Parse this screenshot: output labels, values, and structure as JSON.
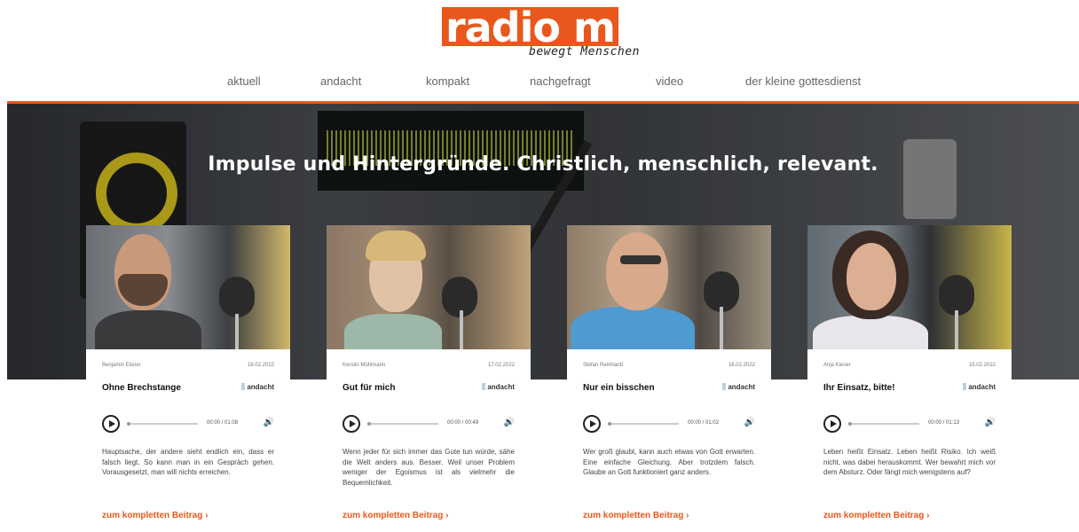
{
  "brand": {
    "logo_text": "radio m",
    "tagline": "bewegt Menschen",
    "accent": "#e8581c"
  },
  "nav": {
    "items": [
      "aktuell",
      "andacht",
      "kompakt",
      "nachgefragt",
      "video",
      "der kleine gottesdienst"
    ]
  },
  "hero": {
    "title": "Impulse und Hintergründe. Christlich, menschlich, relevant."
  },
  "cards": [
    {
      "author": "Benjamin Elsner",
      "date": "18.02.2022",
      "title": "Ohne Brechstange",
      "tag": "andacht",
      "time": "00:00 / 01:08",
      "text": "Hauptsache, der andere sieht endlich ein, dass er falsch liegt. So kann man in ein Gespräch gehen. Vorausgesetzt, man will nichts erreichen.",
      "more": "zum kompletten Beitrag ›"
    },
    {
      "author": "Kerstin Mühlmann",
      "date": "17.02.2022",
      "title": "Gut für mich",
      "tag": "andacht",
      "time": "00:00 / 00:49",
      "text": "Wenn jeder für sich immer das Gute tun würde, sähe die Welt anders aus. Besser. Weil unser Problem weniger der Egoismus ist als vielmehr die Bequemlichkeit.",
      "more": "zum kompletten Beitrag ›"
    },
    {
      "author": "Stefan Reinhardt",
      "date": "16.02.2022",
      "title": "Nur ein bisschen",
      "tag": "andacht",
      "time": "00:00 / 01:02",
      "text": "Wer groß glaubt, kann auch etwas von Gott erwarten. Eine einfache Gleichung. Aber trotzdem falsch. Glaube an Gott funktioniert ganz anders.",
      "more": "zum kompletten Beitrag ›"
    },
    {
      "author": "Anja Kieser",
      "date": "15.02.2022",
      "title": "Ihr Einsatz, bitte!",
      "tag": "andacht",
      "time": "00:00 / 01:13",
      "text": "Leben heißt Einsatz. Leben heißt Risiko. Ich weiß nicht, was dabei herauskommt. Wer bewahrt mich vor dem Absturz. Oder fängt mich wenigstens auf?",
      "more": "zum kompletten Beitrag ›"
    }
  ]
}
